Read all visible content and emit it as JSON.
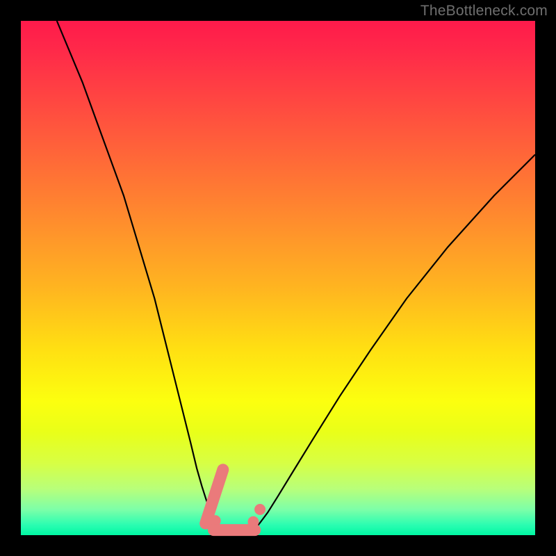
{
  "watermark": "TheBottleneck.com",
  "chart_data": {
    "type": "line",
    "title": "",
    "xlabel": "",
    "ylabel": "",
    "xlim": [
      0,
      100
    ],
    "ylim": [
      0,
      100
    ],
    "series": [
      {
        "name": "left_curve",
        "x": [
          7,
          12,
          16,
          20,
          23,
          26,
          28,
          30,
          31.5,
          33,
          34.2,
          35.2,
          36,
          36.7,
          37.3,
          37.8,
          38.2,
          38.5
        ],
        "y": [
          100,
          88,
          77,
          66,
          56,
          46,
          38,
          30,
          24,
          18,
          13,
          9.5,
          7,
          5,
          3.5,
          2.4,
          1.6,
          1.2
        ]
      },
      {
        "name": "right_curve",
        "x": [
          45.5,
          46.5,
          48,
          50,
          53,
          57,
          62,
          68,
          75,
          83,
          92,
          100
        ],
        "y": [
          1.2,
          2.4,
          4.4,
          7.6,
          12.5,
          19,
          27,
          36,
          46,
          56,
          66,
          74
        ]
      },
      {
        "name": "valley_floor",
        "x": [
          38.5,
          40,
          42,
          44,
          45.5
        ],
        "y": [
          1.2,
          0.9,
          0.8,
          0.9,
          1.2
        ]
      }
    ],
    "annotations": [
      {
        "type": "segment",
        "name": "pink_left",
        "x": 37.6,
        "y": 7.5,
        "angle_deg": 72,
        "length": 11
      },
      {
        "type": "dot",
        "name": "pink_left_joint",
        "x": 37.8,
        "y": 2.8
      },
      {
        "type": "segment",
        "name": "pink_bottom",
        "x": 41.5,
        "y": 1.0,
        "angle_deg": 0,
        "length": 8
      },
      {
        "type": "dot",
        "name": "pink_right_joint",
        "x": 45.2,
        "y": 2.6
      },
      {
        "type": "dot",
        "name": "pink_right_upper",
        "x": 46.5,
        "y": 5.0
      }
    ]
  }
}
